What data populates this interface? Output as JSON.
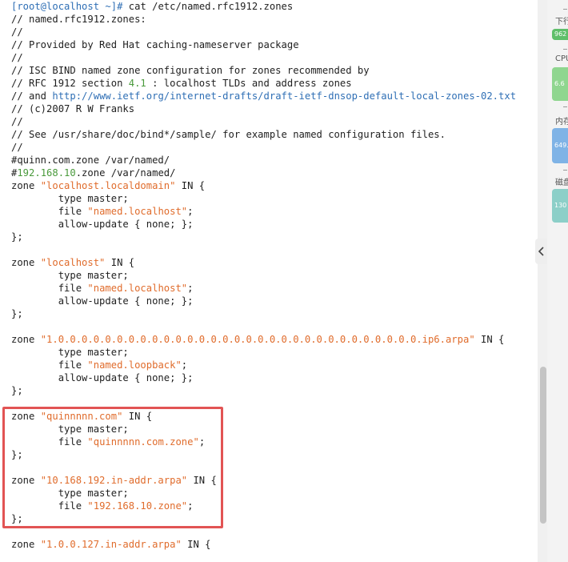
{
  "terminal": {
    "prompt": "[root@localhost ~]#",
    "command": "cat /etc/named.rfc1912.zones",
    "lines": [
      "// named.rfc1912.zones:",
      "//",
      "// Provided by Red Hat caching-nameserver package",
      "//",
      "// ISC BIND named zone configuration for zones recommended by",
      "// RFC 1912 section ",
      "4.1",
      " : localhost TLDs and address zones",
      "// and ",
      "http://www.ietf.org/internet-drafts/draft-ietf-dnsop-default-local-zones-02.txt",
      "// (c)2007 R W Franks",
      "//",
      "// See /usr/share/doc/bind*/sample/ for example named configuration files.",
      "//",
      "#quinn.com.zone /var/named/",
      "#",
      "192.168.10",
      ".zone /var/named/",
      "zone ",
      "\"localhost.localdomain\"",
      " IN {",
      "        type master;",
      "        file ",
      "\"named.localhost\"",
      ";",
      "        allow-update { none; };",
      "};",
      "zone ",
      "\"localhost\"",
      " IN {",
      "        type master;",
      "        file ",
      "\"named.localhost\"",
      ";",
      "        allow-update { none; };",
      "};",
      "zone ",
      "\"1.0.0.0.0.0.0.0.0.0.0.0.0.0.0.0.0.0.0.0.0.0.0.0.0.0.0.0.0.0.0.0.ip6.arpa\"",
      " IN {",
      "        type master;",
      "        file ",
      "\"named.loopback\"",
      ";",
      "        allow-update { none; };",
      "};",
      "zone ",
      "\"quinnnnn.com\"",
      " IN {",
      "        type master;",
      "        file ",
      "\"quinnnnn.com.zone\"",
      ";",
      "};",
      "zone ",
      "\"10.168.192.in-addr.arpa\"",
      " IN {",
      "        type master;",
      "        file ",
      "\"192.168.10.zone\"",
      ";",
      "};",
      "zone ",
      "\"1.0.0.127.in-addr.arpa\"",
      " IN {"
    ]
  },
  "monitor": {
    "download_label": "下行",
    "download_value": "962",
    "cpu_label": "CPU",
    "cpu_value": "6.6",
    "mem_label": "内存",
    "mem_value": "649.",
    "disk_label": "磁盘",
    "disk_value": "130"
  },
  "colors": {
    "string": "#e06c2c",
    "number": "#4a9a3c",
    "url": "#2f6fb5",
    "highlight": "#e25454"
  },
  "icons": {
    "collapse": "chevron-left-icon"
  }
}
